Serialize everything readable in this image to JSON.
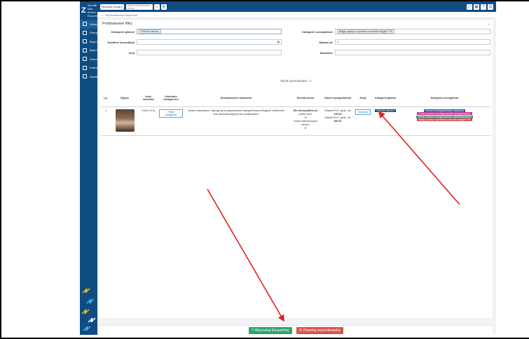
{
  "sidebar": {
    "logo": "Z",
    "user_name": "Skinner Miła",
    "user_role": "Strona Ekspertów",
    "items": [
      {
        "label": "Wyszukiwarka Ekspertów",
        "icon": "users-icon",
        "active": true
      },
      {
        "label": "Oceny Ekspertów",
        "icon": "star-icon",
        "active": false
      },
      {
        "label": "Moje konto",
        "icon": "user-icon",
        "active": false
      },
      {
        "label": "Moje konsultacje",
        "icon": "chat-icon",
        "active": false
      },
      {
        "label": "Dokumenty",
        "icon": "document-icon",
        "active": false
      },
      {
        "label": "Kalkulatory (WIP)",
        "icon": "calculator-icon",
        "active": false
      },
      {
        "label": "Asystent AI",
        "icon": "robot-icon",
        "active": false
      }
    ]
  },
  "topbar": {
    "module_select": "Wszystkie moduły",
    "search_placeholder": "Wpisz szukaną frazę i wciśnij",
    "search_icon": "search-icon",
    "filter_icon": "gear-icon"
  },
  "breadcrumb": {
    "label": "Wyszukiwarka Ekspertów"
  },
  "filters": {
    "title": "Podstawowe filtry",
    "main_categories_label": "Kategorie główne",
    "main_categories_value": "Kontrole nadzoru",
    "sub_categories_label": "Kategorie szczegółowe",
    "sub_categories_value": "Biegły sądowy w sprawach przeciwko biegłym / FA",
    "deadline_label": "Deadline konsultacji",
    "rate_label": "Stawka do",
    "rate_value": "0",
    "first_name_label": "Imię",
    "last_name_label": "Nazwisko"
  },
  "results": {
    "count_label": "Wynik wyszukiwania - 1",
    "headers": [
      "Lp.",
      "Zdjęcie",
      "Imię i nazwisko",
      "Kalendarz dostępności",
      "Doświadczenie zawodowe",
      "Średnia ocena",
      "Zakres wynagrodzenia",
      "Akcje",
      "Kategoria główna",
      "Kategoria szczegółowa"
    ],
    "rows": [
      {
        "index": "1",
        "name": "Kalina Grey",
        "calendar_button": "Pokaż dostępność",
        "experience": "Jestem adwokatem, zajmuję się postępowaniami dyscyplinarnymi biegłych rewidentów oraz administracyjnymi firm audytorskich.",
        "rating_text": "Nie skorzystałeś/-aś",
        "rating_count_label": "Liczba ocen:",
        "rating_count": "0",
        "consultations_label": "Liczba zakończonych zleceń:",
        "consultations_count": "0",
        "rate_from_label": "Stawka PLN / godz. od:",
        "rate_from": "150.00",
        "rate_to_label": "Stawka PLN / godz. do:",
        "rate_to": "350.00",
        "action_button": "Konsultuj",
        "main_category": "Kontrole nadzoru",
        "sub_categories": [
          {
            "label": "Pomoc w korespondencji z nadzorem",
            "color": "#2e5fa6"
          },
          {
            "label": "Pomoc prawna w postępowaniach dyscyplinarnych",
            "color": "#c02d8c"
          },
          {
            "label": "Pomoc prawna w postępowaniach administracyjnych",
            "color": "#3f8f7a"
          },
          {
            "label": "Biegły sądowy w sprawach przeciwko biegłym / FA",
            "color": "#d9464a"
          }
        ]
      }
    ]
  },
  "footer": {
    "search_button": "Wyszukaj Ekspertów",
    "reset_button": "Zresetuj wyszukiwarkę"
  },
  "colors": {
    "primary": "#0f4c81",
    "search_button": "#2ea36a",
    "reset_button": "#d9534f",
    "annotation_arrow": "#e02020"
  }
}
